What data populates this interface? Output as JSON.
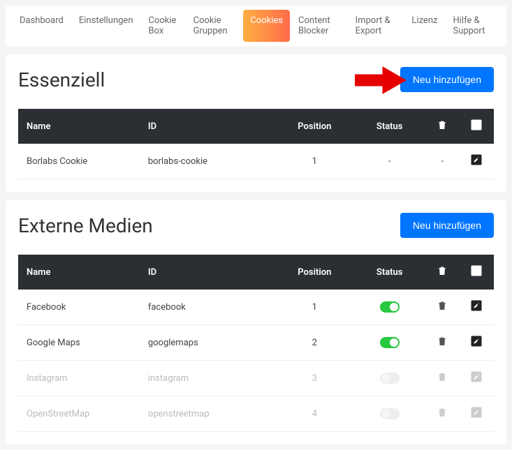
{
  "nav": {
    "items": [
      {
        "label": "Dashboard"
      },
      {
        "label": "Einstellungen"
      },
      {
        "label": "Cookie Box"
      },
      {
        "label": "Cookie Gruppen"
      },
      {
        "label": "Cookies",
        "active": true
      },
      {
        "label": "Content Blocker"
      },
      {
        "label": "Import & Export"
      },
      {
        "label": "Lizenz"
      },
      {
        "label": "Hilfe & Support"
      }
    ]
  },
  "table_headers": {
    "name": "Name",
    "id": "ID",
    "position": "Position",
    "status": "Status"
  },
  "buttons": {
    "add": "Neu hinzufügen"
  },
  "sections": [
    {
      "title": "Essenziell",
      "rows": [
        {
          "name": "Borlabs Cookie",
          "id": "borlabs-cookie",
          "position": "1",
          "status": "-",
          "delete": "-",
          "edit": true
        }
      ]
    },
    {
      "title": "Externe Medien",
      "rows": [
        {
          "name": "Facebook",
          "id": "facebook",
          "position": "1",
          "toggle": "on"
        },
        {
          "name": "Google Maps",
          "id": "googlemaps",
          "position": "2",
          "toggle": "on"
        },
        {
          "name": "Instagram",
          "id": "instagram",
          "position": "3",
          "toggle": "off",
          "faded": true
        },
        {
          "name": "OpenStreetMap",
          "id": "openstreetmap",
          "position": "4",
          "toggle": "off",
          "faded": true
        }
      ]
    }
  ]
}
